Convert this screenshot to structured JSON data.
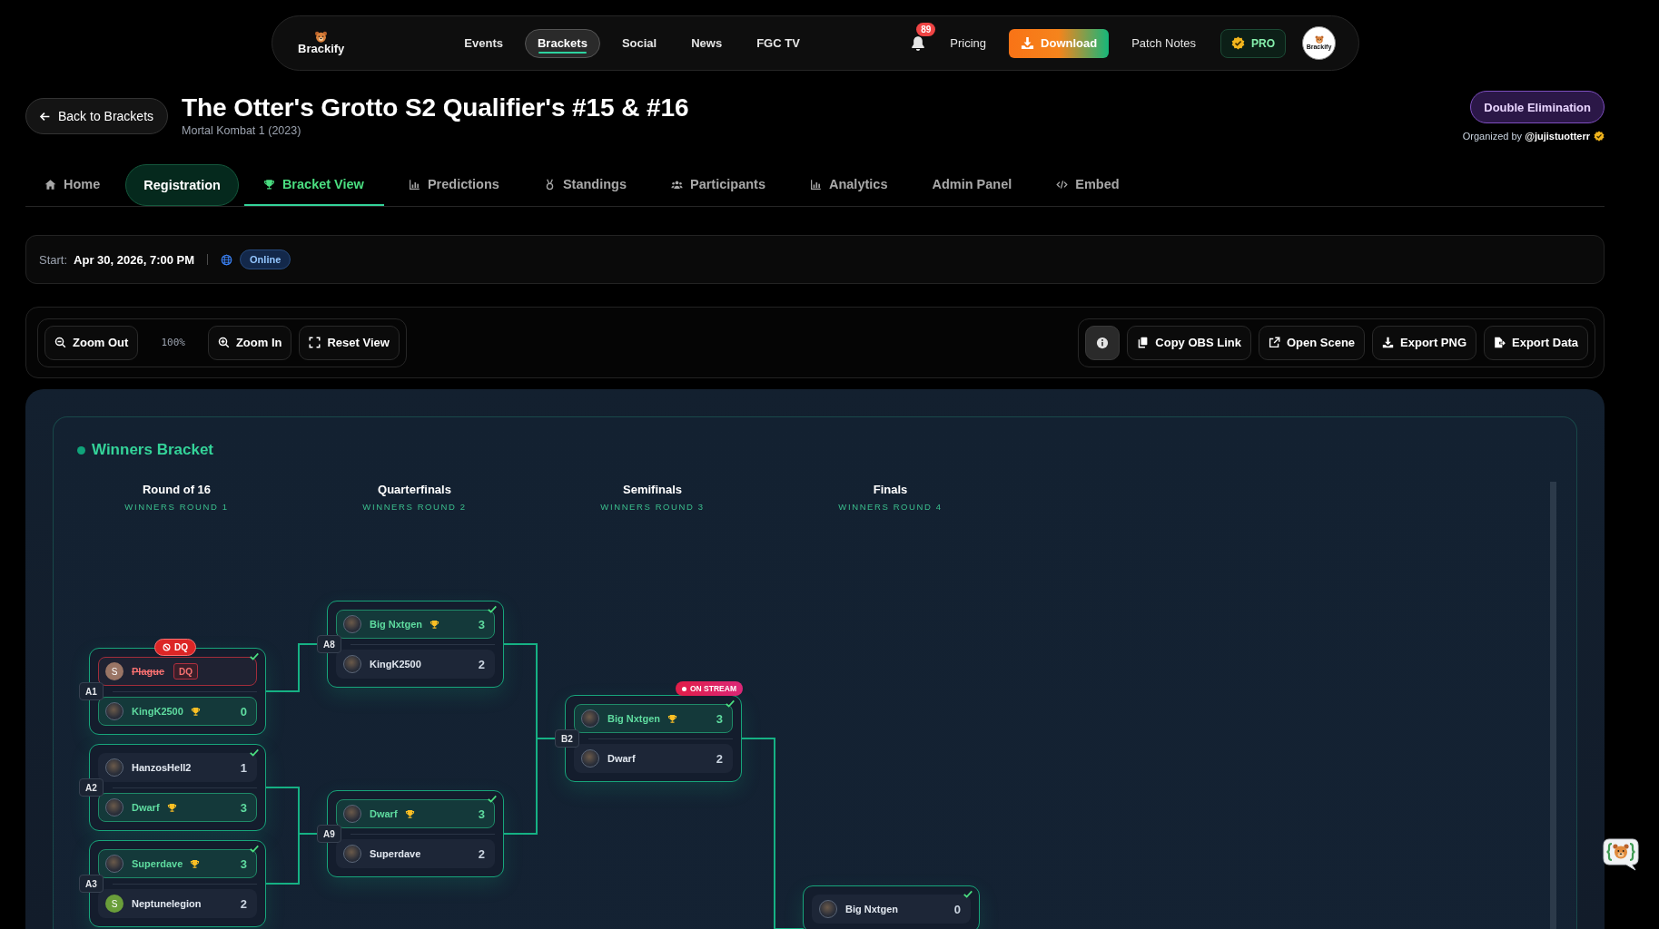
{
  "nav": {
    "logo": "Brackify",
    "items": [
      {
        "label": "Events",
        "selected": false
      },
      {
        "label": "Brackets",
        "selected": true
      },
      {
        "label": "Social",
        "selected": false
      },
      {
        "label": "News",
        "selected": false
      },
      {
        "label": "FGC TV",
        "selected": false
      }
    ],
    "notification_count": "89",
    "actions": [
      {
        "label": "Pricing",
        "kind": "link"
      },
      {
        "label": "Download",
        "kind": "download"
      },
      {
        "label": "Patch Notes",
        "kind": "link"
      },
      {
        "label": "PRO",
        "kind": "pro"
      }
    ],
    "avatar": "Brackify"
  },
  "header": {
    "back": "Back to Brackets",
    "title": "The Otter's Grotto S2 Qualifier's #15 & #16",
    "game": "Mortal Kombat 1 (2023)",
    "format": "Double Elimination",
    "organizer": "Organized by **@jujistuotterr**",
    "verified": true
  },
  "tabs": [
    {
      "label": "Home",
      "kind": "tab",
      "selected": false
    },
    {
      "label": "Registration",
      "kind": "pill",
      "selected": false
    },
    {
      "label": "Bracket View",
      "kind": "tab",
      "selected": true
    },
    {
      "label": "Predictions",
      "kind": "tab",
      "selected": false
    },
    {
      "label": "Standings",
      "kind": "tab",
      "selected": false
    },
    {
      "label": "Participants",
      "kind": "tab",
      "selected": false
    },
    {
      "label": "Analytics",
      "kind": "tab",
      "selected": false
    },
    {
      "label": "Admin Panel",
      "kind": "tab",
      "selected": false
    },
    {
      "label": "Embed",
      "kind": "tab",
      "selected": false
    }
  ],
  "event": {
    "start_label": "Start:",
    "start": "Apr 30, 2026, 7:00 PM",
    "location": "Online"
  },
  "toolbar": {
    "zoom_out": "Zoom Out",
    "zoom_level": "100%",
    "zoom_in": "Zoom In",
    "reset": "Reset View",
    "actions": [
      "Copy OBS Link",
      "Open Scene",
      "Export PNG",
      "Export Data"
    ]
  },
  "bracket": {
    "title": "Winners Bracket",
    "rounds": [
      {
        "name": "Round of 16",
        "subtitle": "WINNERS ROUND 1",
        "matches": [
          {
            "label": "A1",
            "completed": true,
            "badge": {
              "kind": "dq",
              "text": "DQ"
            },
            "players": [
              {
                "name": "Plague",
                "initial": "S",
                "color": "#9a7565",
                "tag": "DQ",
                "winner": false,
                "disqualified": true
              },
              {
                "name": "KingK2500",
                "score": "0",
                "winner": true,
                "disqualified": false
              }
            ]
          },
          {
            "label": "A2",
            "completed": true,
            "players": [
              {
                "name": "HanzosHell2",
                "score": "1",
                "winner": false,
                "disqualified": false
              },
              {
                "name": "Dwarf",
                "score": "3",
                "winner": true,
                "disqualified": false
              }
            ]
          },
          {
            "label": "A3",
            "completed": true,
            "players": [
              {
                "name": "Superdave",
                "score": "3",
                "winner": true,
                "disqualified": false
              },
              {
                "name": "Neptunelegion",
                "initial": "S",
                "color": "#6a9e3a",
                "score": "2",
                "winner": false,
                "disqualified": false
              }
            ]
          }
        ]
      },
      {
        "name": "Quarterfinals",
        "subtitle": "WINNERS ROUND 2",
        "matches": [
          {
            "label": "A8",
            "completed": true,
            "players": [
              {
                "name": "Big Nxtgen",
                "score": "3",
                "winner": true,
                "disqualified": false
              },
              {
                "name": "KingK2500",
                "score": "2",
                "winner": false,
                "disqualified": false
              }
            ]
          },
          {
            "label": "A9",
            "completed": true,
            "players": [
              {
                "name": "Dwarf",
                "score": "3",
                "winner": true,
                "disqualified": false
              },
              {
                "name": "Superdave",
                "score": "2",
                "winner": false,
                "disqualified": false
              }
            ]
          }
        ]
      },
      {
        "name": "Semifinals",
        "subtitle": "WINNERS ROUND 3",
        "matches": [
          {
            "label": "B2",
            "completed": true,
            "badge": {
              "kind": "stream",
              "text": "ON STREAM"
            },
            "players": [
              {
                "name": "Big Nxtgen",
                "score": "3",
                "winner": true,
                "disqualified": false
              },
              {
                "name": "Dwarf",
                "score": "2",
                "winner": false,
                "disqualified": false
              }
            ]
          }
        ]
      },
      {
        "name": "Finals",
        "subtitle": "WINNERS ROUND 4",
        "matches": [
          {
            "completed": true,
            "players": [
              {
                "name": "Big Nxtgen",
                "score": "0",
                "winner": false,
                "disqualified": false
              }
            ]
          }
        ]
      }
    ]
  }
}
